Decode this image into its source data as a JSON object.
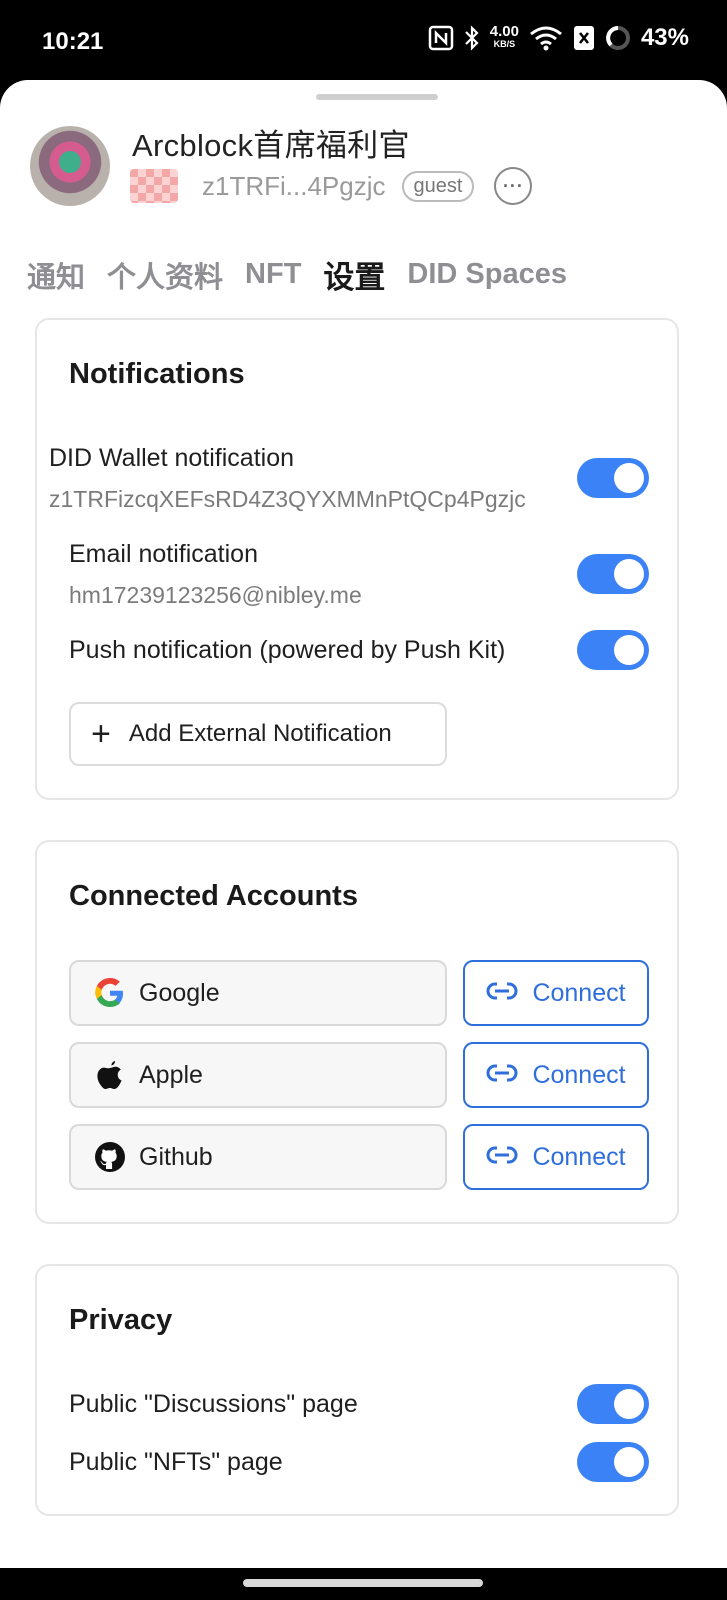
{
  "status_bar": {
    "time": "10:21",
    "net_speed": "4.00",
    "net_unit": "KB/S",
    "battery": "43%",
    "icons": [
      "nfc-icon",
      "bluetooth-icon",
      "wifi-icon",
      "sim-icon",
      "battery-ring-icon"
    ]
  },
  "profile": {
    "name": "Arcblock首席福利官",
    "did_short": "z1TRFi...4Pgzjc",
    "role_badge": "guest",
    "more_label": "···"
  },
  "tabs": [
    {
      "label": "通知",
      "active": false
    },
    {
      "label": "个人资料",
      "active": false
    },
    {
      "label": "NFT",
      "active": false
    },
    {
      "label": "设置",
      "active": true
    },
    {
      "label": "DID Spaces",
      "active": false
    }
  ],
  "notifications": {
    "title": "Notifications",
    "items": [
      {
        "label": "DID Wallet notification",
        "sub": "z1TRFizcqXEFsRD4Z3QYXMMnPtQCp4Pgzjc",
        "enabled": true
      },
      {
        "label": "Email notification",
        "sub": "hm17239123256@nibley.me",
        "enabled": true
      },
      {
        "label": "Push notification (powered by Push Kit)",
        "sub": "",
        "enabled": true
      }
    ],
    "add_button": "Add External Notification"
  },
  "connected_accounts": {
    "title": "Connected Accounts",
    "accounts": [
      {
        "provider": "Google",
        "icon": "google-icon",
        "action": "Connect"
      },
      {
        "provider": "Apple",
        "icon": "apple-icon",
        "action": "Connect"
      },
      {
        "provider": "Github",
        "icon": "github-icon",
        "action": "Connect"
      }
    ]
  },
  "privacy": {
    "title": "Privacy",
    "items": [
      {
        "label": "Public \"Discussions\" page",
        "enabled": true
      },
      {
        "label": "Public \"NFTs\" page",
        "enabled": true
      }
    ]
  },
  "colors": {
    "accent": "#3b82f6",
    "link": "#2f6fdb"
  }
}
